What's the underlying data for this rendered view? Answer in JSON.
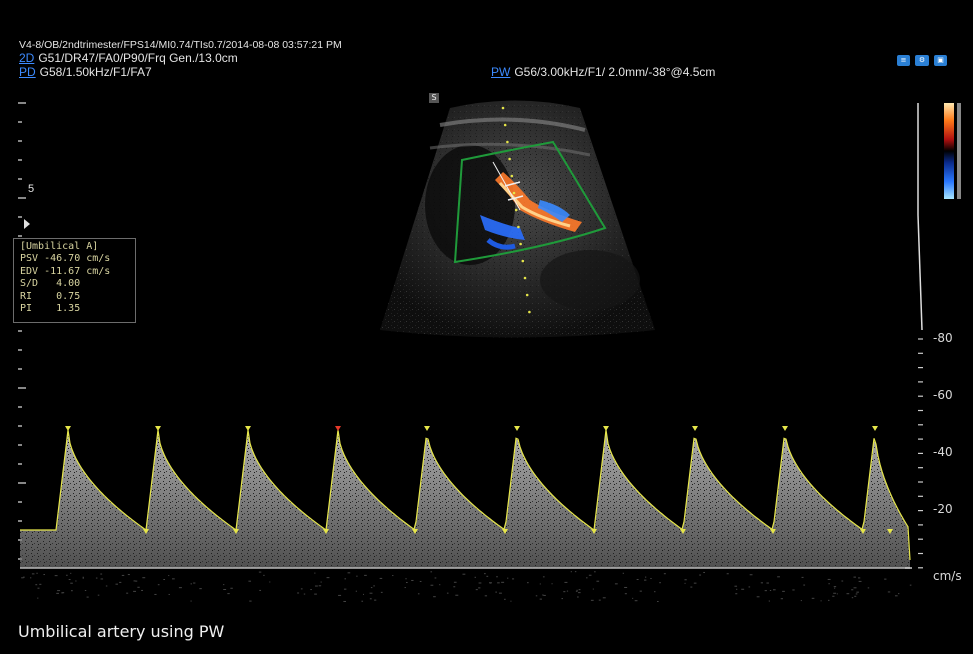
{
  "header": {
    "line1": "V4-8/OB/2ndtrimester/FPS14/MI0.74/TIs0.7/2014-08-08 03:57:21 PM",
    "mode_2d": "2D",
    "line2": "G51/DR47/FA0/P90/Frq Gen./13.0cm",
    "mode_pd": "PD",
    "line3": "G58/1.50kHz/F1/FA7",
    "mode_pw": "PW",
    "pw_params": "G56/3.00kHz/F1/ 2.0mm/-38°@4.5cm"
  },
  "icons": [
    "freeze-icon",
    "settings-icon",
    "display-icon"
  ],
  "depth_marker": "5",
  "image_marker": "S",
  "measurement": {
    "title": "[Umbilical A]",
    "rows": [
      {
        "label": "PSV",
        "value": "-46.70 cm/s"
      },
      {
        "label": "EDV",
        "value": "-11.67 cm/s"
      },
      {
        "label": "S/D",
        "value": "4.00"
      },
      {
        "label": "RI",
        "value": "0.75"
      },
      {
        "label": "PI",
        "value": "1.35"
      }
    ]
  },
  "velocity_scale": {
    "unit": "cm/s",
    "ticks": [
      "-80",
      "-60",
      "-40",
      "-20"
    ]
  },
  "colors": {
    "waveform": "#c0c0c0",
    "trace": "#e6e64a",
    "roi_box": "#1f9a3a",
    "accent_blue": "#2a7fd4",
    "selected_marker": "#e63a2a"
  },
  "caption": "Umbilical artery using PW"
}
